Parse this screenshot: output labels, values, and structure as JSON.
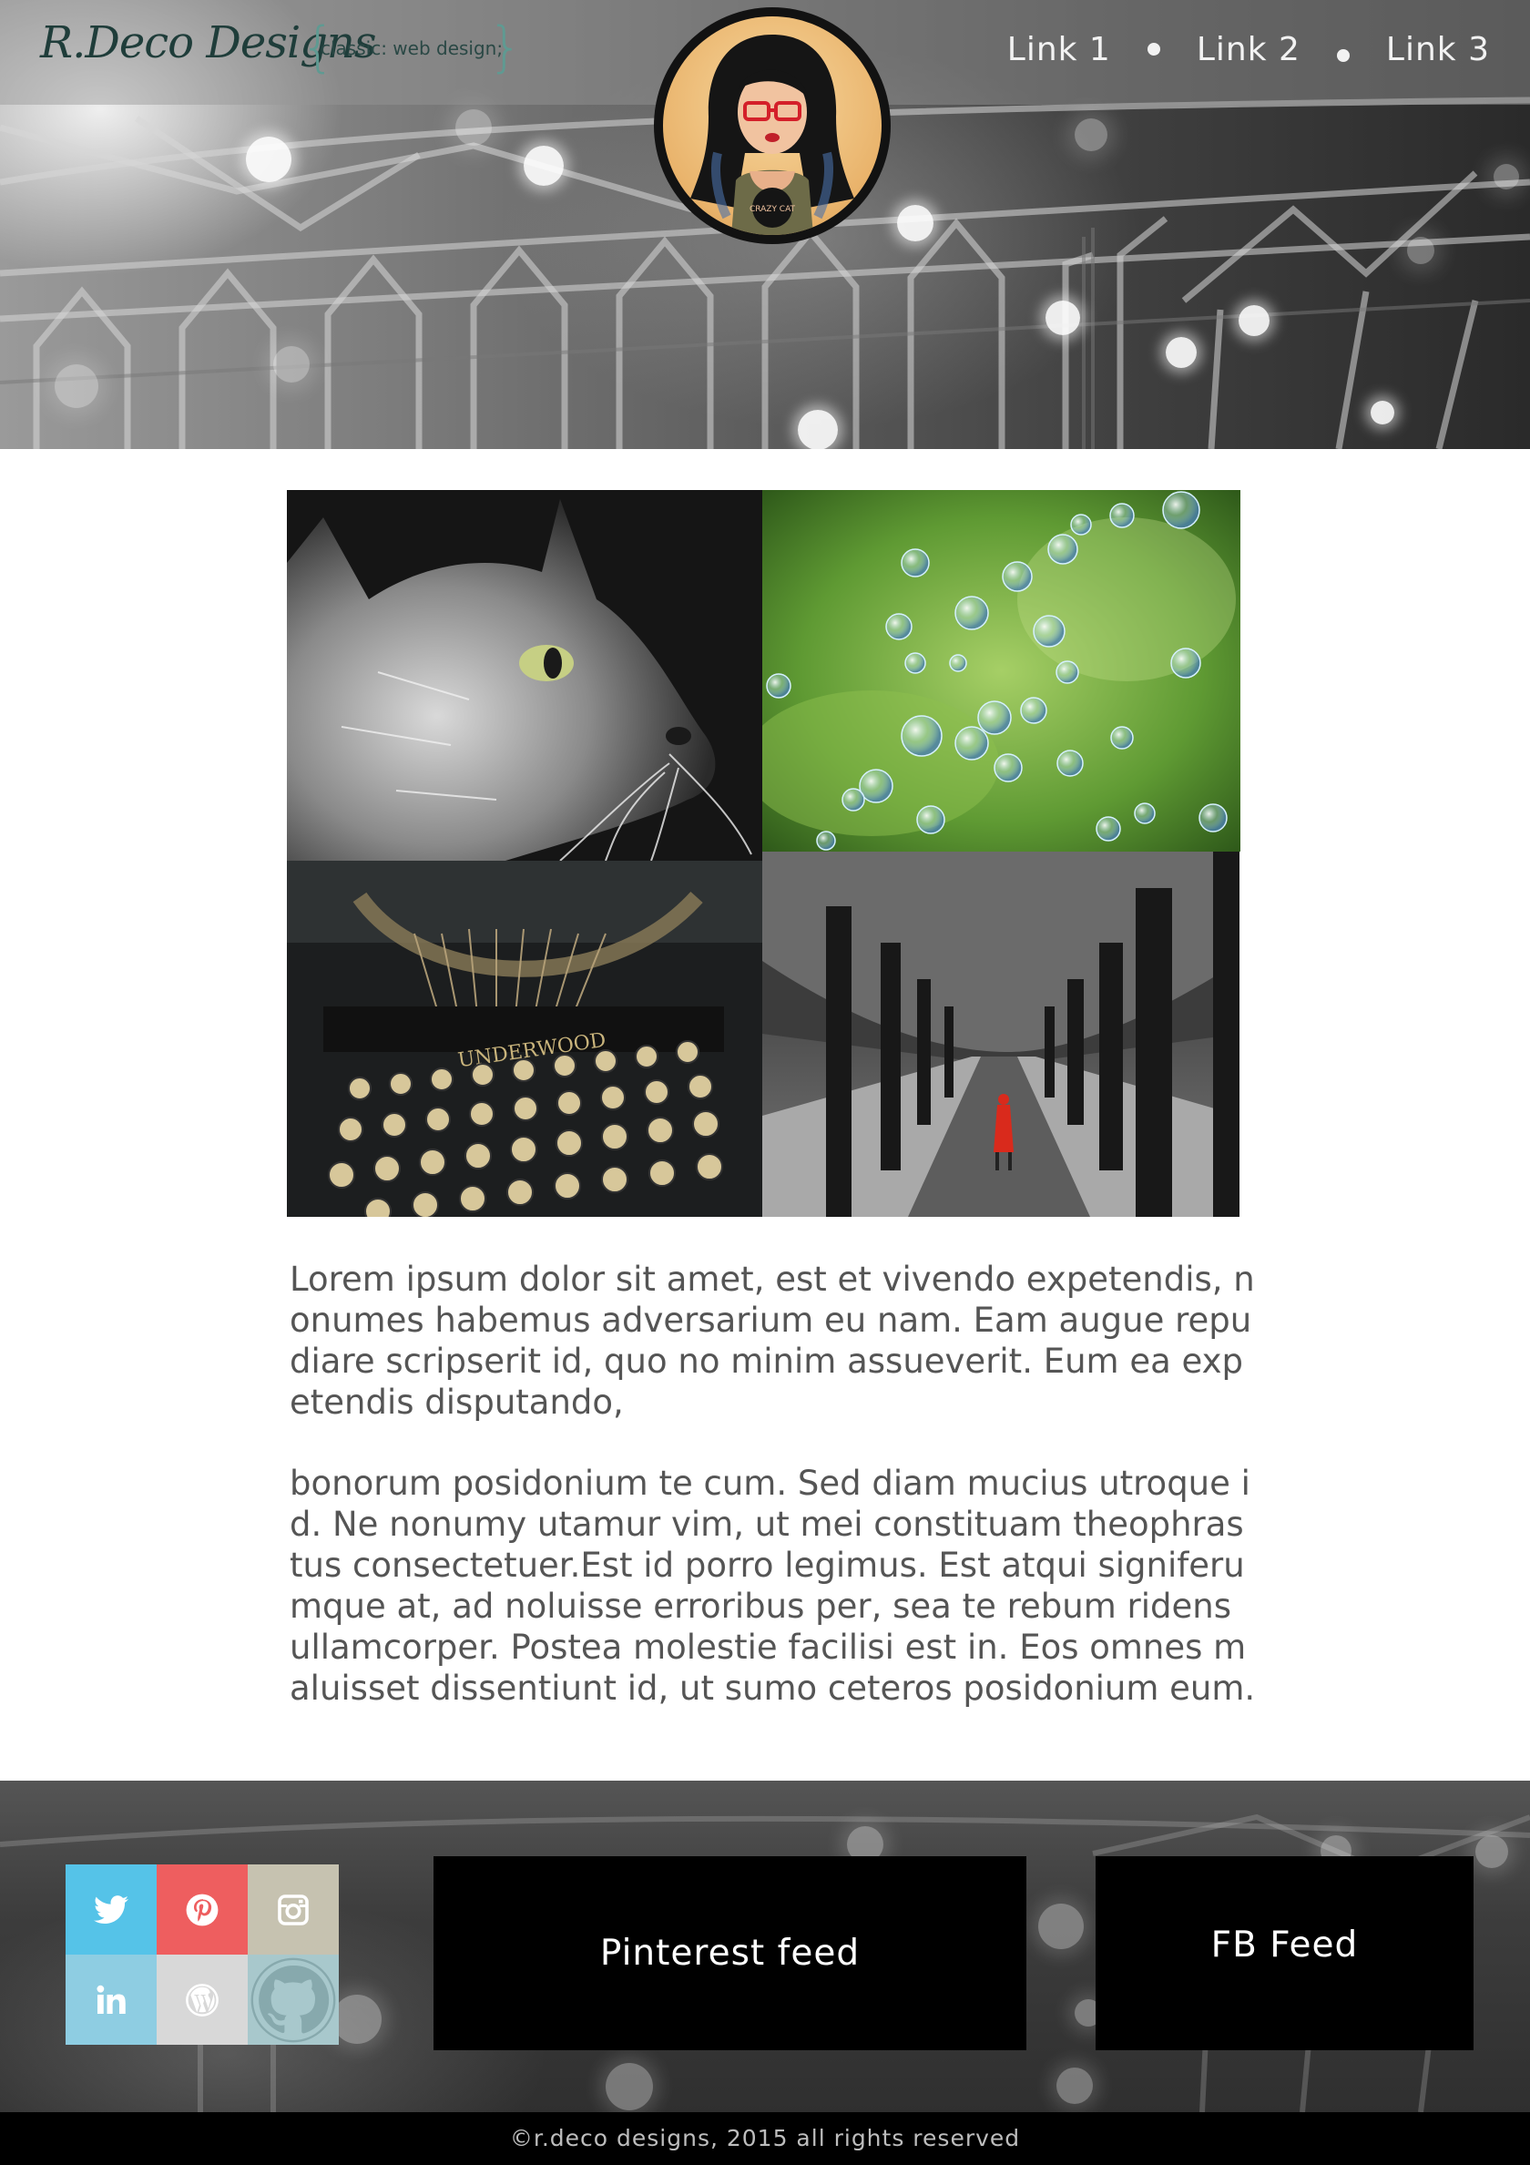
{
  "header": {
    "logo_script": "R.Deco Designs",
    "logo_tagline": "classic: web design;",
    "avatar_badge": "CRAZY CAT",
    "nav": [
      {
        "label": "Link 1"
      },
      {
        "label": "Link 2"
      },
      {
        "label": "Link 3"
      }
    ]
  },
  "gallery": {
    "typewriter_brand": "UNDERWOOD"
  },
  "content": {
    "paragraphs": [
      "Lorem ipsum dolor sit amet, est et vivendo expetendis, nonumes habemus adversarium eu nam. Eam augue repudiare scripserit id, quo no minim assueverit. Eum ea expetendis disputando,",
      "bonorum posidonium te cum. Sed diam mucius utroque id. Ne nonumy utamur vim, ut mei constituam theophrastus consectetuer.Est id porro legimus. Est atqui signiferumque at, ad noluisse erroribus per, sea te rebum ridens ullamcorper. Postea molestie facilisi est in. Eos omnes maluisset dissentiunt id, ut sumo ceteros posidonium eum."
    ]
  },
  "footer": {
    "social": [
      {
        "icon": "twitter-icon",
        "color": "#55c3e8"
      },
      {
        "icon": "pinterest-icon",
        "color": "#ee5e5f"
      },
      {
        "icon": "instagram-icon",
        "color": "#c6c2b0"
      },
      {
        "icon": "linkedin-icon",
        "color": "#8ecde2"
      },
      {
        "icon": "wordpress-icon",
        "color": "#d8d8d8"
      },
      {
        "icon": "github-icon",
        "color": "#a8c8cc"
      }
    ],
    "pinterest_feed_label": "Pinterest feed",
    "fb_feed_label": "FB Feed",
    "copyright": "©r.deco designs, 2015 all rights reserved"
  }
}
